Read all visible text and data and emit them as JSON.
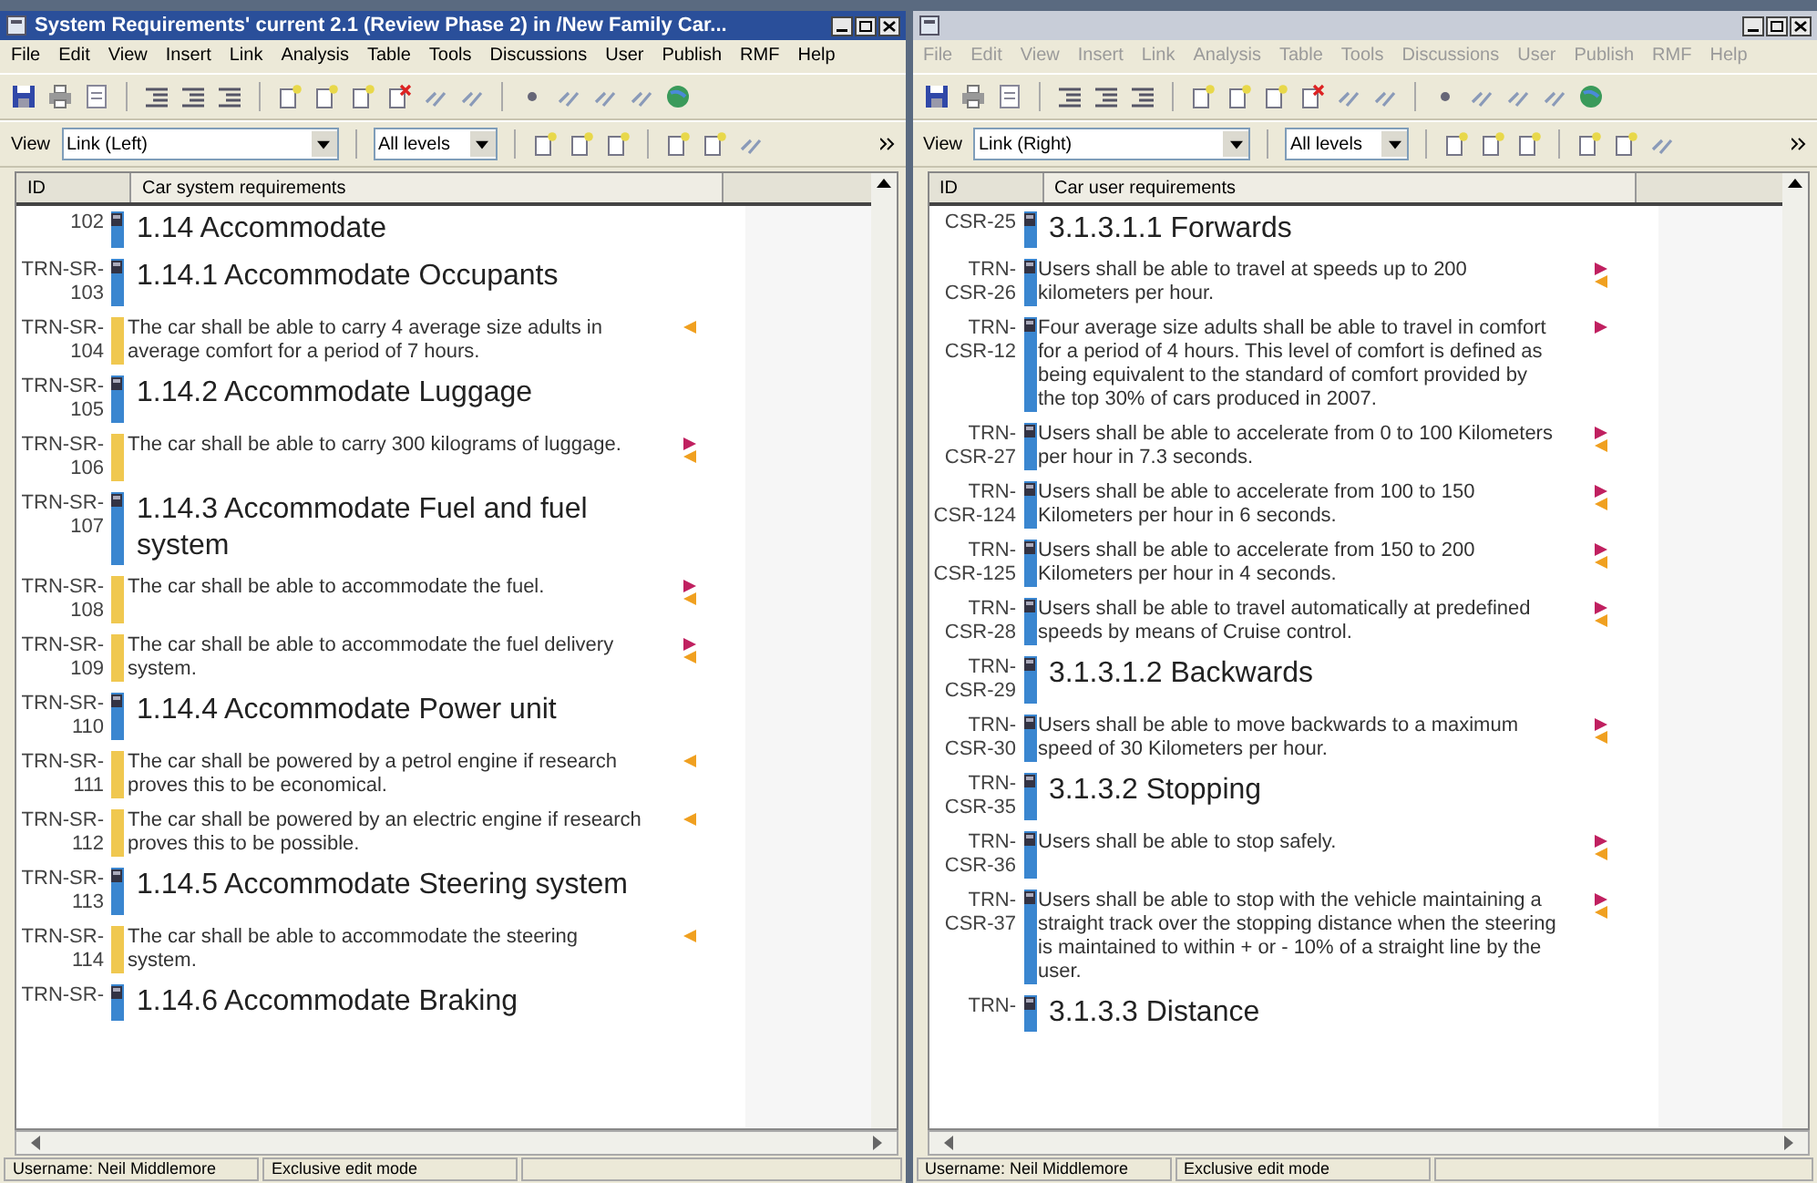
{
  "windows": [
    {
      "active": true,
      "title": "System Requirements' current 2.1 (Review Phase 2) in /New Family Car...",
      "menu": [
        "File",
        "Edit",
        "View",
        "Insert",
        "Link",
        "Analysis",
        "Table",
        "Tools",
        "Discussions",
        "User",
        "Publish",
        "RMF",
        "Help"
      ],
      "view_label": "View",
      "view": "Link (Left)",
      "levels": "All levels",
      "columns": [
        "ID",
        "Car system requirements"
      ],
      "rows": [
        {
          "id": "102",
          "kind": "heading",
          "text": "1.14 Accommodate",
          "color": "#3a86d0",
          "marker": true,
          "out_link": false,
          "in_link": false
        },
        {
          "id": "TRN-SR-103",
          "kind": "heading",
          "text": "1.14.1 Accommodate Occupants",
          "color": "#3a86d0",
          "marker": true,
          "out_link": false,
          "in_link": false
        },
        {
          "id": "TRN-SR-104",
          "kind": "text",
          "text": "The car shall be able to carry 4 average size adults in average comfort for a period of 7 hours.",
          "color": "#f0c850",
          "marker": false,
          "out_link": false,
          "in_link": true
        },
        {
          "id": "TRN-SR-105",
          "kind": "heading",
          "text": "1.14.2 Accommodate Luggage",
          "color": "#3a86d0",
          "marker": true,
          "out_link": false,
          "in_link": false
        },
        {
          "id": "TRN-SR-106",
          "kind": "text",
          "text": "The car shall be able to carry 300 kilograms of luggage.",
          "color": "#f0c850",
          "marker": false,
          "out_link": true,
          "in_link": true
        },
        {
          "id": "TRN-SR-107",
          "kind": "heading",
          "text": "1.14.3 Accommodate Fuel and fuel system",
          "color": "#3a86d0",
          "marker": true,
          "out_link": false,
          "in_link": false
        },
        {
          "id": "TRN-SR-108",
          "kind": "text",
          "text": "The car shall be able to accommodate the fuel.",
          "color": "#f0c850",
          "marker": false,
          "out_link": true,
          "in_link": true
        },
        {
          "id": "TRN-SR-109",
          "kind": "text",
          "text": "The car shall be able to accommodate the fuel delivery system.",
          "color": "#f0c850",
          "marker": false,
          "out_link": true,
          "in_link": true
        },
        {
          "id": "TRN-SR-110",
          "kind": "heading",
          "text": "1.14.4 Accommodate Power unit",
          "color": "#3a86d0",
          "marker": true,
          "out_link": false,
          "in_link": false
        },
        {
          "id": "TRN-SR-111",
          "kind": "text",
          "text": "The car shall be powered by a petrol engine if research proves this to be economical.",
          "color": "#f0c850",
          "marker": false,
          "out_link": false,
          "in_link": true
        },
        {
          "id": "TRN-SR-112",
          "kind": "text",
          "text": "The car shall be powered by an electric engine if research proves this to be possible.",
          "color": "#f0c850",
          "marker": false,
          "out_link": false,
          "in_link": true
        },
        {
          "id": "TRN-SR-113",
          "kind": "heading",
          "text": "1.14.5 Accommodate Steering system",
          "color": "#3a86d0",
          "marker": true,
          "out_link": false,
          "in_link": false
        },
        {
          "id": "TRN-SR-114",
          "kind": "text",
          "text": "The car shall be able to accommodate the steering system.",
          "color": "#f0c850",
          "marker": false,
          "out_link": false,
          "in_link": true
        },
        {
          "id": "TRN-SR-",
          "kind": "heading",
          "text": "1.14.6 Accommodate Braking",
          "color": "#3a86d0",
          "marker": true,
          "out_link": false,
          "in_link": false
        }
      ],
      "status": [
        "Username: Neil Middlemore",
        "Exclusive edit mode"
      ]
    },
    {
      "active": false,
      "menu": [
        "File",
        "Edit",
        "View",
        "Insert",
        "Link",
        "Analysis",
        "Table",
        "Tools",
        "Discussions",
        "User",
        "Publish",
        "RMF",
        "Help"
      ],
      "view_label": "View",
      "view": "Link (Right)",
      "levels": "All levels",
      "columns": [
        "ID",
        "Car user requirements"
      ],
      "rows": [
        {
          "id": "CSR-25",
          "kind": "heading",
          "text": "3.1.3.1.1 Forwards",
          "color": "#3a86d0",
          "marker": true,
          "out_link": false,
          "in_link": false
        },
        {
          "id": "TRN-CSR-26",
          "kind": "text",
          "text": "Users shall be able to travel at speeds up to 200 kilometers per hour.",
          "color": "#3a86d0",
          "marker": true,
          "out_link": true,
          "in_link": true
        },
        {
          "id": "TRN-CSR-12",
          "kind": "text",
          "text": "Four average size adults shall be able to travel in comfort for a period of 4 hours. This level of comfort is defined as being equivalent to the standard of comfort provided by the top 30% of cars produced in 2007.",
          "color": "#3a86d0",
          "marker": true,
          "out_link": true,
          "in_link": false
        },
        {
          "id": "TRN-CSR-27",
          "kind": "text",
          "text": "Users shall be able to accelerate from 0 to 100 Kilometers per hour in 7.3 seconds.",
          "color": "#3a86d0",
          "marker": true,
          "out_link": true,
          "in_link": true
        },
        {
          "id": "TRN-CSR-124",
          "kind": "text",
          "text": "Users shall be able to accelerate from 100 to 150 Kilometers per hour in 6 seconds.",
          "color": "#3a86d0",
          "marker": true,
          "out_link": true,
          "in_link": true
        },
        {
          "id": "TRN-CSR-125",
          "kind": "text",
          "text": "Users shall be able to accelerate from 150 to 200 Kilometers per hour in 4 seconds.",
          "color": "#3a86d0",
          "marker": true,
          "out_link": true,
          "in_link": true
        },
        {
          "id": "TRN-CSR-28",
          "kind": "text",
          "text": "Users shall be able to travel automatically at predefined speeds by means of Cruise control.",
          "color": "#3a86d0",
          "marker": true,
          "out_link": true,
          "in_link": true
        },
        {
          "id": "TRN-CSR-29",
          "kind": "heading",
          "text": "3.1.3.1.2 Backwards",
          "color": "#3a86d0",
          "marker": true,
          "out_link": false,
          "in_link": false
        },
        {
          "id": "TRN-CSR-30",
          "kind": "text",
          "text": "Users shall be able to move backwards to a maximum speed of 30 Kilometers per hour.",
          "color": "#3a86d0",
          "marker": true,
          "out_link": true,
          "in_link": true
        },
        {
          "id": "TRN-CSR-35",
          "kind": "heading",
          "text": "3.1.3.2 Stopping",
          "color": "#3a86d0",
          "marker": true,
          "out_link": false,
          "in_link": false
        },
        {
          "id": "TRN-CSR-36",
          "kind": "text",
          "text": "Users shall be able to stop safely.",
          "color": "#3a86d0",
          "marker": true,
          "out_link": true,
          "in_link": true
        },
        {
          "id": "TRN-CSR-37",
          "kind": "text",
          "text": "Users shall be able to stop with the vehicle maintaining a straight track over the stopping distance when the steering is maintained to within + or - 10% of a straight line by the user.",
          "color": "#3a86d0",
          "marker": true,
          "out_link": true,
          "in_link": true
        },
        {
          "id": "TRN-",
          "kind": "heading",
          "text": "3.1.3.3 Distance",
          "color": "#3a86d0",
          "marker": true,
          "out_link": false,
          "in_link": false
        }
      ],
      "status": [
        "Username: Neil Middlemore",
        "Exclusive edit mode"
      ]
    }
  ]
}
